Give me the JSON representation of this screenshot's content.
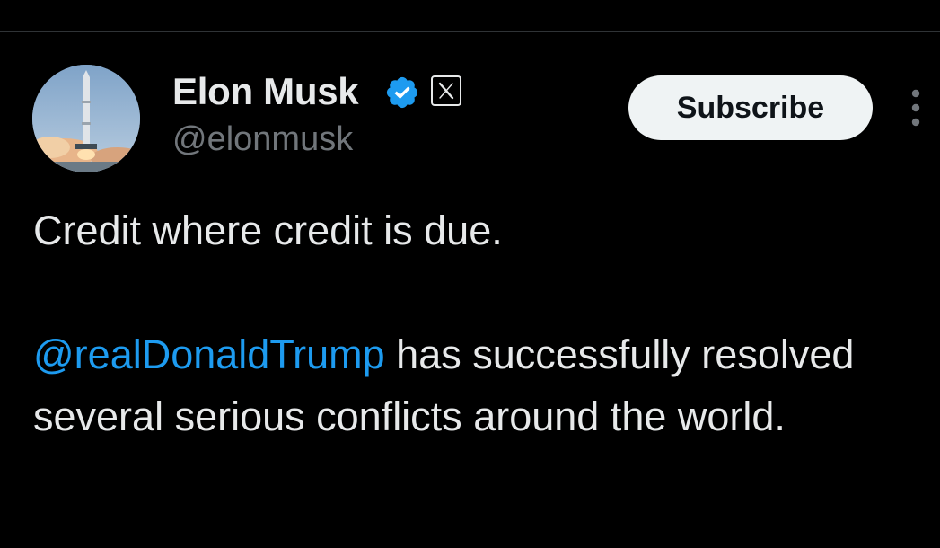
{
  "post": {
    "author": {
      "display_name": "Elon Musk",
      "handle": "@elonmusk",
      "verified": true,
      "verified_color": "#1d9bf0",
      "affiliate_icon": "x-logo-icon",
      "avatar_icon": "rocket-launch-avatar"
    },
    "subscribe_label": "Subscribe",
    "more_icon": "more-vertical-icon",
    "text": {
      "line1": "Credit where credit is due.",
      "mention": "@realDonaldTrump",
      "line2_rest": " has successfully resolved several serious conflicts around the world."
    }
  },
  "colors": {
    "background": "#000000",
    "text": "#e7e9ea",
    "secondary_text": "#71767b",
    "link": "#1d9bf0",
    "button_bg": "#eff3f4",
    "button_text": "#0f1419"
  }
}
